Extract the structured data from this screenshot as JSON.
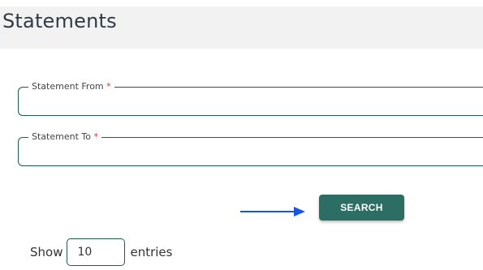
{
  "page": {
    "title": "Statements"
  },
  "form": {
    "statement_from": {
      "label": "Statement From",
      "required_mark": "*",
      "value": ""
    },
    "statement_to": {
      "label": "Statement To",
      "required_mark": "*",
      "value": ""
    },
    "search_label": "SEARCH"
  },
  "table_controls": {
    "show_label": "Show",
    "entries_value": "10",
    "entries_label": "entries"
  },
  "colors": {
    "accent": "#2c6e63",
    "border": "#1f5c4c",
    "arrow": "#1a56db",
    "required": "#d32f2f"
  },
  "icons": {
    "pointer": "arrow-right-icon"
  }
}
